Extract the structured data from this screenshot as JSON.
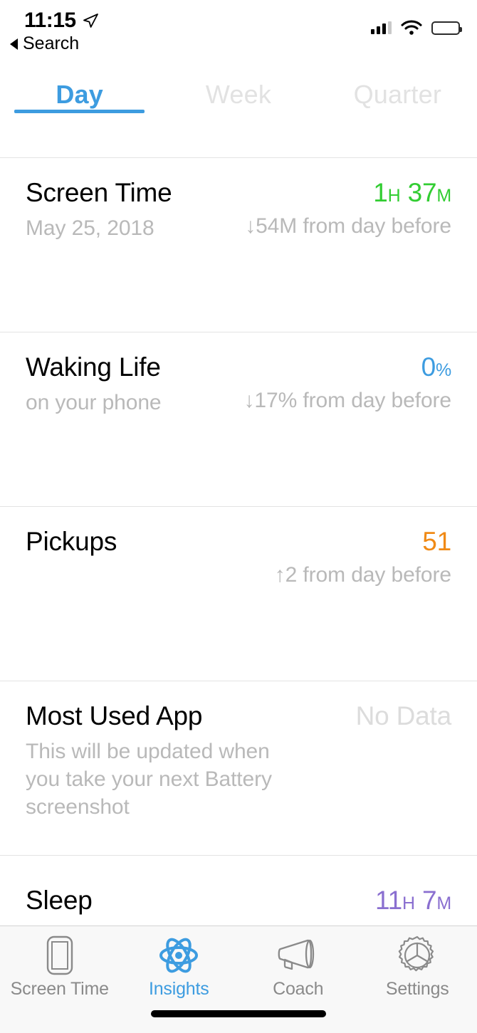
{
  "status_bar": {
    "time": "11:15",
    "location_icon": "location-arrow-icon",
    "back_label": "Search",
    "signal_icon": "cellular-signal-icon",
    "wifi_icon": "wifi-icon",
    "battery_icon": "battery-low-icon",
    "signal_bars_filled": 3,
    "signal_bars_total": 4,
    "battery_percent": 20
  },
  "segmented_tabs": {
    "items": [
      {
        "label": "Day",
        "active": true
      },
      {
        "label": "Week",
        "active": false
      },
      {
        "label": "Quarter",
        "active": false
      }
    ]
  },
  "rows": [
    {
      "title": "Screen Time",
      "subtitle": "May 25, 2018",
      "value_number": "1",
      "value_unit_1": "H",
      "value_number_2": "37",
      "value_unit_2": "M",
      "value_color": "#32cd32",
      "delta": "↓54M from day before"
    },
    {
      "title": "Waking Life",
      "subtitle": "on your phone",
      "value_number": "0",
      "value_unit_1": "%",
      "value_color": "#3d9ce0",
      "delta": "↓17% from day before"
    },
    {
      "title": "Pickups",
      "subtitle": "",
      "value_number": "51",
      "value_color": "#f08a16",
      "delta": "↑2 from day before"
    },
    {
      "title": "Most Used App",
      "subtitle": "This will be updated when you take your next Battery screenshot",
      "value_number": "No Data",
      "value_color": "#dcdcdc",
      "delta": ""
    },
    {
      "title": "Sleep",
      "subtitle": "",
      "value_number": "11",
      "value_unit_1": "H",
      "value_number_2": "7",
      "value_unit_2": "M",
      "value_color": "#8a6fd0",
      "delta": ""
    }
  ],
  "tab_bar": {
    "items": [
      {
        "label": "Screen Time",
        "icon": "phone-icon",
        "active": false
      },
      {
        "label": "Insights",
        "icon": "atom-icon",
        "active": true
      },
      {
        "label": "Coach",
        "icon": "megaphone-icon",
        "active": false
      },
      {
        "label": "Settings",
        "icon": "gear-icon",
        "active": false
      }
    ]
  },
  "colors": {
    "accent": "#3d9ce0",
    "green": "#32cd32",
    "orange": "#f08a16",
    "purple": "#8a6fd0",
    "muted": "#b9b9b9"
  }
}
